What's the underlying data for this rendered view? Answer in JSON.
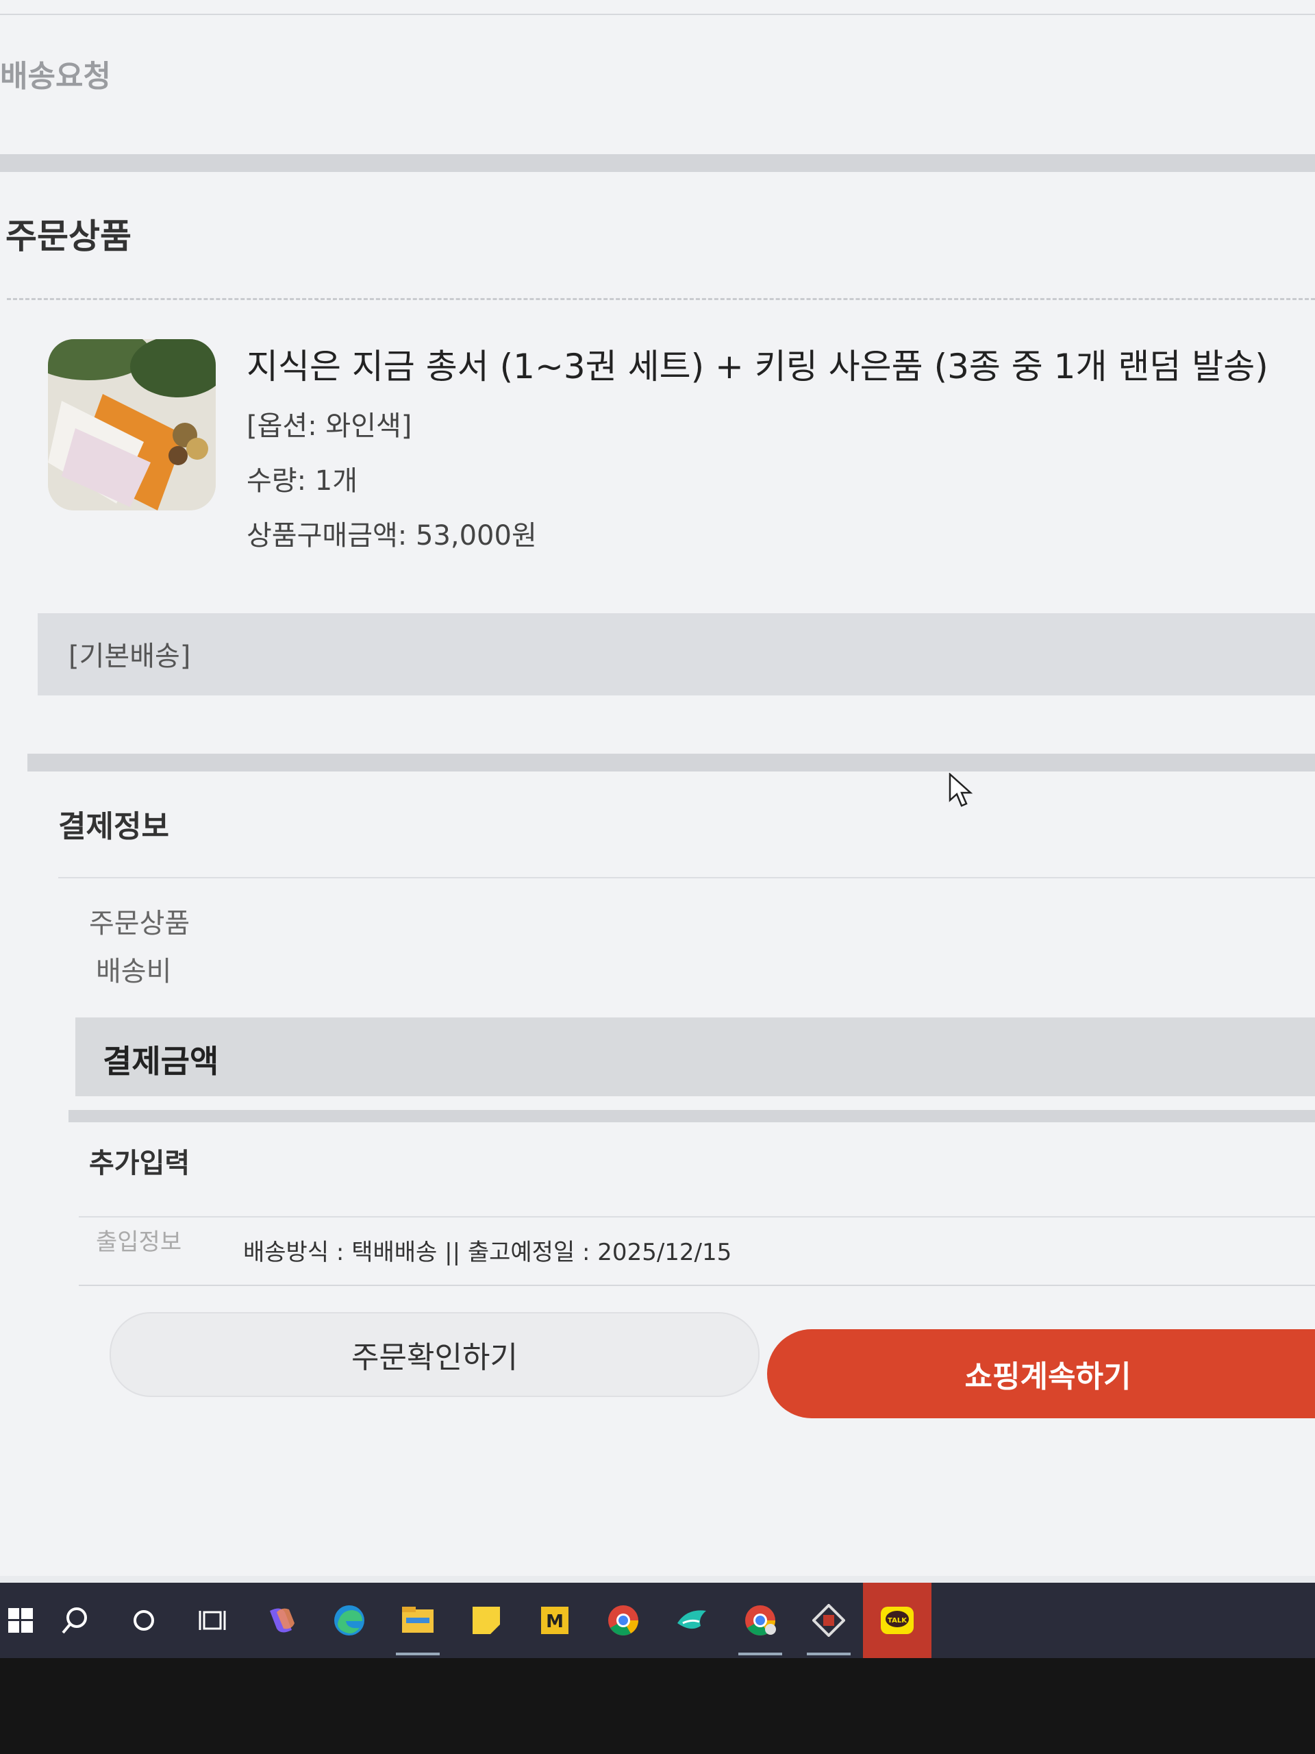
{
  "header": {
    "delivery_request": "배송요청"
  },
  "order": {
    "title": "주문상품",
    "product": {
      "name": "지식은 지금 총서 (1~3권 세트) + 키링 사은품 (3종 중 1개 랜덤 발송)",
      "option": "[옵션: 와인색]",
      "quantity": "수량: 1개",
      "price": "상품구매금액: 53,000원"
    },
    "shipping_type": "[기본배송]"
  },
  "payment": {
    "title": "결제정보",
    "items_label": "주문상품",
    "shipping_fee_label": "배송비",
    "total_label": "결제금액"
  },
  "extra": {
    "title": "추가입력",
    "label": "출입정보",
    "value": "배송방식 : 택배배송 || 출고예정일 : 2025/12/15"
  },
  "buttons": {
    "confirm": "주문확인하기",
    "continue": "쇼핑계속하기"
  },
  "colors": {
    "accent": "#d9452b",
    "background": "#f2f3f5",
    "taskbar": "#2a2c3a"
  },
  "taskbar": {
    "icons": [
      "windows-start-icon",
      "search-icon",
      "cortana-icon",
      "task-view-icon",
      "copilot-icon",
      "edge-icon",
      "file-explorer-icon",
      "sticky-notes-icon",
      "m-app-icon",
      "chrome-icon",
      "bird-app-icon",
      "chrome-profile-icon",
      "stamp-app-icon",
      "kakaotalk-icon"
    ],
    "kakaotalk_badge": "TALK"
  }
}
